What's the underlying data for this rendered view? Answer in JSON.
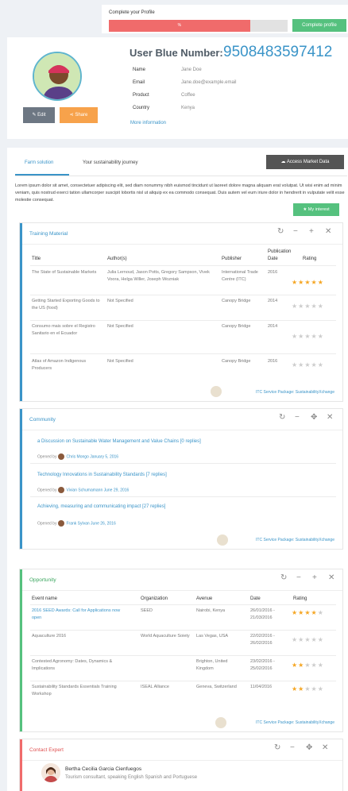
{
  "profile_bar": {
    "label": "Complete your Profile",
    "percent_text": "%",
    "progress": 0.79,
    "button": "Complete profile"
  },
  "profile": {
    "ubn_label": "User Blue Number:",
    "ubn_value": "9508483597412",
    "fields": [
      {
        "k": "Name",
        "v": "Jane Doe"
      },
      {
        "k": "Email",
        "v": "Jane.doe@example.email"
      },
      {
        "k": "Product",
        "v": "Coffee"
      },
      {
        "k": "Country",
        "v": "Kenya"
      }
    ],
    "more_info": "More information",
    "edit": "Edit",
    "share": "Share"
  },
  "tabs": {
    "farm": "Farm solution",
    "journey": "Your sustainability journey"
  },
  "market_button": "Access Market Data",
  "intro_text": "Lorem ipsum dolor sit amet, consectetuer adipiscing elit, sed diam nonummy nibh euismod tincidunt ut laoreet dolore magna aliquam erat volutpat. Ut wisi enim ad minim veniam, quis nostrud exerci tation ullamcorper suscipit lobortis nisl ut aliquip ex ea commodo consequat. Duis autem vel eum iriure dolor in hendrerit in vulputate velit esse molestie consequat.",
  "interest_button": "My interest",
  "training": {
    "title": "Training Material",
    "headers": {
      "title": "Title",
      "authors": "Author(s)",
      "publisher": "Publisher",
      "date": "Publication Date",
      "rating": "Rating"
    },
    "rows": [
      {
        "title": "The State of Sustainable Markets",
        "authors": "Julia Lernoud, Jason Potts, Gregory Sampson, Vivek Voora, Helga Willer, Joseph Wozniak",
        "publisher": "International Trade Centre (ITC)",
        "date": "2016",
        "rating": 5
      },
      {
        "title": "Getting Started Exporting Goods to the US (food)",
        "authors": "Not Specified",
        "publisher": "Canopy Bridge",
        "date": "2014",
        "rating": 0
      },
      {
        "title": "Consumo mais sobre el Registro Sanitario en el Ecuador",
        "authors": "Not Specified",
        "publisher": "Canopy Bridge",
        "date": "2014",
        "rating": 0
      },
      {
        "title": "Atlas of Amazon Indigenous Producers",
        "authors": "Not Specified",
        "publisher": "Canopy Bridge",
        "date": "2016",
        "rating": 0
      }
    ],
    "footer": "ITC Service Package: SustainabilityXchange"
  },
  "community": {
    "title": "Community",
    "posts": [
      {
        "title": "a Discussion on Sustainable Water Management and Value Chains [0 replies]",
        "by": "Opened by",
        "author": "Chris Mongo January 5, 2016"
      },
      {
        "title": "Technology Innovations in Sustainability Standards [7 replies]",
        "by": "Opened by",
        "author": "Vivian Schumamann June 29, 2016"
      },
      {
        "title": "Achieving, measuring and communicating impact [27 replies]",
        "by": "Opened by",
        "author": "Frank Sylvan June 26, 2016"
      }
    ],
    "footer": "ITC Service Package: SustainabilityXchange"
  },
  "opportunity": {
    "title": "Opportunity",
    "headers": {
      "event": "Event name",
      "org": "Organization",
      "avenue": "Avenue",
      "date": "Date",
      "rating": "Rating"
    },
    "rows": [
      {
        "event": "2016 SEED Awards: Call for Applications now open",
        "org": "SEED",
        "avenue": "Nairobi, Kenya",
        "date": "26/01/2016 - 21/03/2016",
        "rating": 4
      },
      {
        "event": "Aquaculture 2016",
        "org": "World Aquaculture Soiety",
        "avenue": "Las Vegas, USA",
        "date": "22/02/2016 - 26/02/2016",
        "rating": 0
      },
      {
        "event": "Contested Agronomy: Dates, Dynamics & Implications",
        "org": "",
        "avenue": "Brighton, United Kingdom",
        "date": "23/02/2016 - 25/02/2016",
        "rating": 2
      },
      {
        "event": "Sustainability Standards Essentials Training Workshop",
        "org": "ISEAL Alliance",
        "avenue": "Geneva, Switzerland",
        "date": "11/04/2016",
        "rating": 2
      }
    ],
    "footer": "ITC Service Package: SustainabilityXchange"
  },
  "expert": {
    "title": "Contact Expert",
    "name": "Bertha Cecilia Garcia Cienfuegos",
    "desc": "Tourism consultant, speaking English Spanish and Portuguese"
  },
  "colors": {
    "blue": "#3a94c8",
    "green": "#55c17e",
    "red": "#f06b6b",
    "orange": "#f7a24b"
  }
}
